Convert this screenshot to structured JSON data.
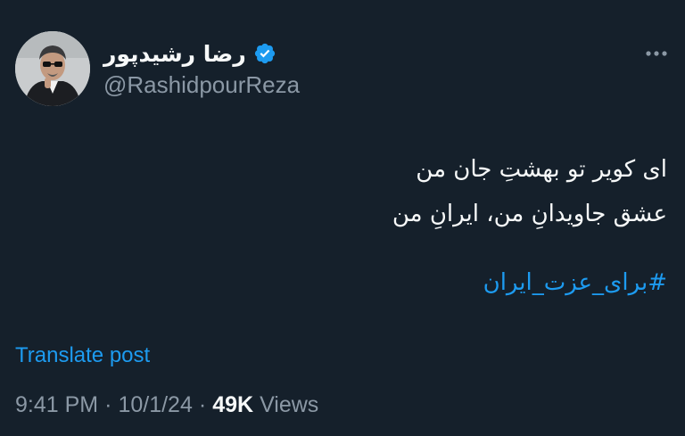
{
  "post": {
    "author": {
      "display_name": "رضا رشیدپور",
      "handle": "@RashidpourReza",
      "verified": true,
      "avatar_icon": "profile-photo"
    },
    "text_lines": [
      "ای کویر تو بهشتِ جان من",
      "عشق جاویدانِ من، ایرانِ من"
    ],
    "hashtag": "#برای_عزت_ایران",
    "translate_label": "Translate post",
    "meta": {
      "time": "9:41 PM",
      "separator": "·",
      "date": "10/1/24",
      "views_count": "49K",
      "views_label": "Views"
    },
    "more_icon": "more-dots-icon"
  },
  "colors": {
    "background": "#15202b",
    "primary_text": "#f7f9f9",
    "secondary_text": "#8b98a5",
    "accent": "#1d9bf0"
  }
}
